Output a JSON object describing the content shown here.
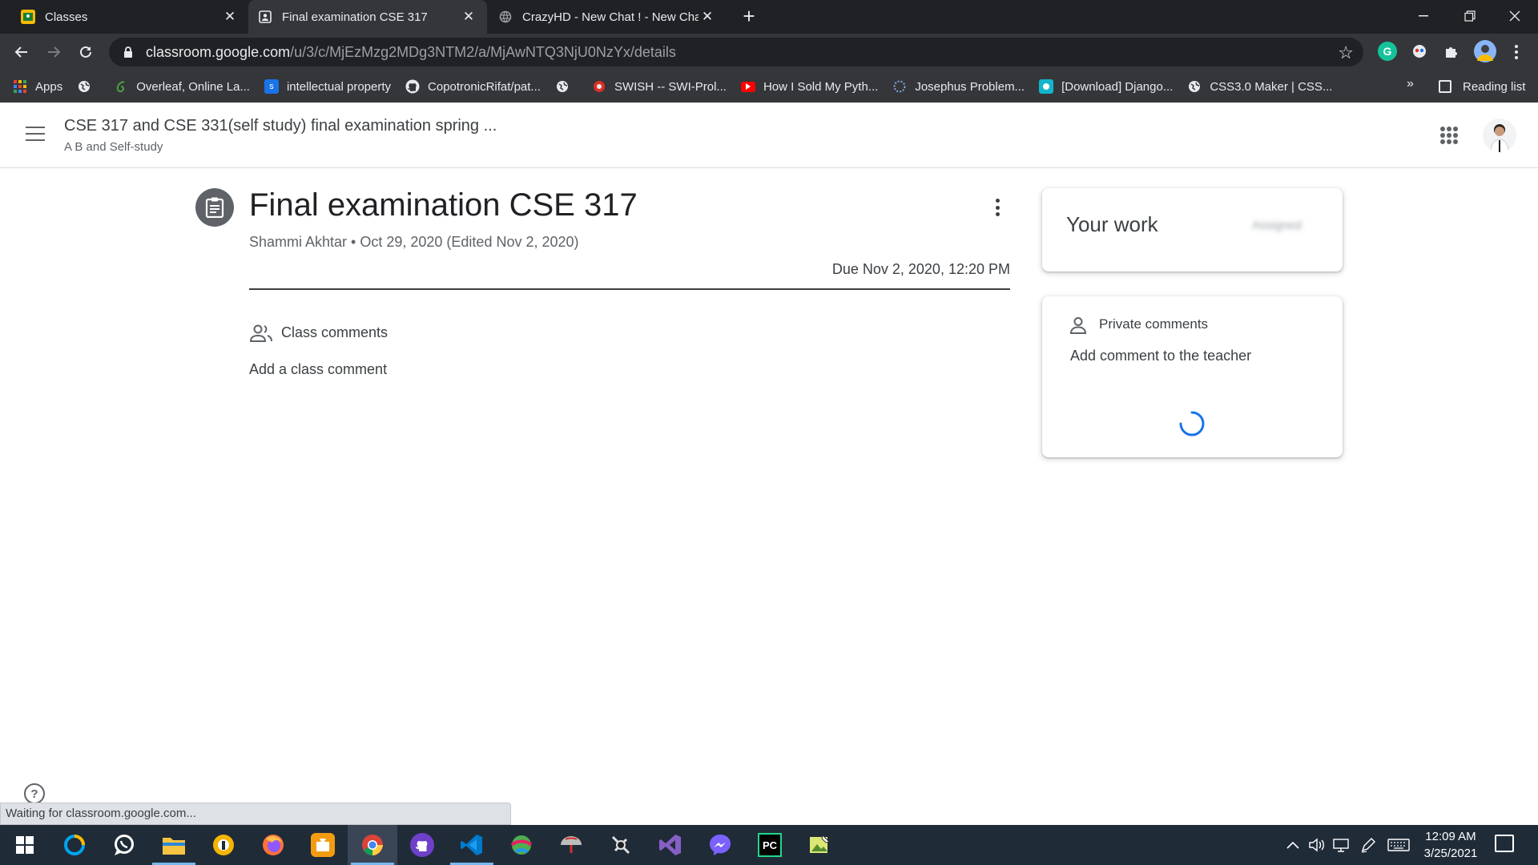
{
  "browser": {
    "tabs": [
      {
        "title": "Classes",
        "active": false,
        "favicon_color": "#fbbc04"
      },
      {
        "title": "Final examination CSE 317",
        "active": true,
        "favicon_color": "#9aa0a6"
      },
      {
        "title": "CrazyHD - New Chat ! - New Cha",
        "active": false,
        "favicon_color": "#5f6368"
      }
    ],
    "url_host": "classroom.google.com",
    "url_path": "/u/3/c/MjEzMzg2MDg3NTM2/a/MjAwNTQ3NjU0NzYx/details",
    "bookmarks": [
      {
        "label": "Apps",
        "icon": "apps-grid-icon",
        "color": "#ea4335"
      },
      {
        "label": "",
        "icon": "globe-icon",
        "color": "#5f6368"
      },
      {
        "label": "Overleaf, Online La...",
        "icon": "overleaf-icon",
        "color": "#47a141"
      },
      {
        "label": "intellectual property",
        "icon": "s-icon",
        "color": "#1a73e8"
      },
      {
        "label": "CopotronicRifat/pat...",
        "icon": "github-icon",
        "color": "#24292e"
      },
      {
        "label": "",
        "icon": "globe-icon",
        "color": "#5f6368"
      },
      {
        "label": "SWISH -- SWI-Prol...",
        "icon": "swish-icon",
        "color": "#d93025"
      },
      {
        "label": "How I Sold My Pyth...",
        "icon": "youtube-icon",
        "color": "#ff0000"
      },
      {
        "label": "Josephus Problem...",
        "icon": "dotted-circle-icon",
        "color": "#1a73e8"
      },
      {
        "label": "[Download] Django...",
        "icon": "download-site-icon",
        "color": "#12b5cb"
      },
      {
        "label": "CSS3.0 Maker | CSS...",
        "icon": "globe-icon",
        "color": "#5f6368"
      }
    ],
    "bookmarks_overflow": "»",
    "reading_list": "Reading list"
  },
  "classroom": {
    "course_title": "CSE 317 and CSE 331(self study) final examination spring ...",
    "course_section": "A B and Self-study",
    "assignment": {
      "title": "Final examination CSE 317",
      "meta": "Shammi Akhtar • Oct 29, 2020 (Edited Nov 2, 2020)",
      "due": "Due Nov 2, 2020, 12:20 PM"
    },
    "class_comments": {
      "label": "Class comments",
      "add": "Add a class comment"
    },
    "your_work": {
      "title": "Your work",
      "status": "Assigned"
    },
    "private_comments": {
      "label": "Private comments",
      "add": "Add comment to the teacher"
    },
    "accent": "#1a73e8"
  },
  "status_bar": "Waiting for classroom.google.com...",
  "taskbar": {
    "apps": [
      {
        "name": "start-button",
        "label": "",
        "color": "#202b38"
      },
      {
        "name": "app-icon-1",
        "label": "",
        "color": "#0078d7"
      },
      {
        "name": "whatsapp-icon",
        "label": "",
        "color": "#25d366"
      },
      {
        "name": "file-explorer-icon",
        "label": "",
        "color": "#f8c342"
      },
      {
        "name": "app-icon-4",
        "label": "",
        "color": "#f5b400"
      },
      {
        "name": "firefox-icon",
        "label": "",
        "color": "#ff7139"
      },
      {
        "name": "app-icon-6",
        "label": "",
        "color": "#f39c12"
      },
      {
        "name": "chrome-icon",
        "label": "",
        "color": "#34a853"
      },
      {
        "name": "github-desktop-icon",
        "label": "",
        "color": "#6e40c9"
      },
      {
        "name": "vscode-icon",
        "label": "",
        "color": "#007acc"
      },
      {
        "name": "app-icon-10",
        "label": "",
        "color": "#4caf50"
      },
      {
        "name": "app-icon-11",
        "label": "",
        "color": "#9e9e9e"
      },
      {
        "name": "app-icon-12",
        "label": "",
        "color": "#455a64"
      },
      {
        "name": "visual-studio-icon",
        "label": "",
        "color": "#865fc5"
      },
      {
        "name": "messenger-icon",
        "label": "",
        "color": "#7b61ff"
      },
      {
        "name": "pycharm-icon",
        "label": "PC",
        "color": "#000000"
      },
      {
        "name": "app-icon-16",
        "label": "",
        "color": "#8bc34a"
      }
    ],
    "time": "12:09 AM",
    "date": "3/25/2021"
  }
}
